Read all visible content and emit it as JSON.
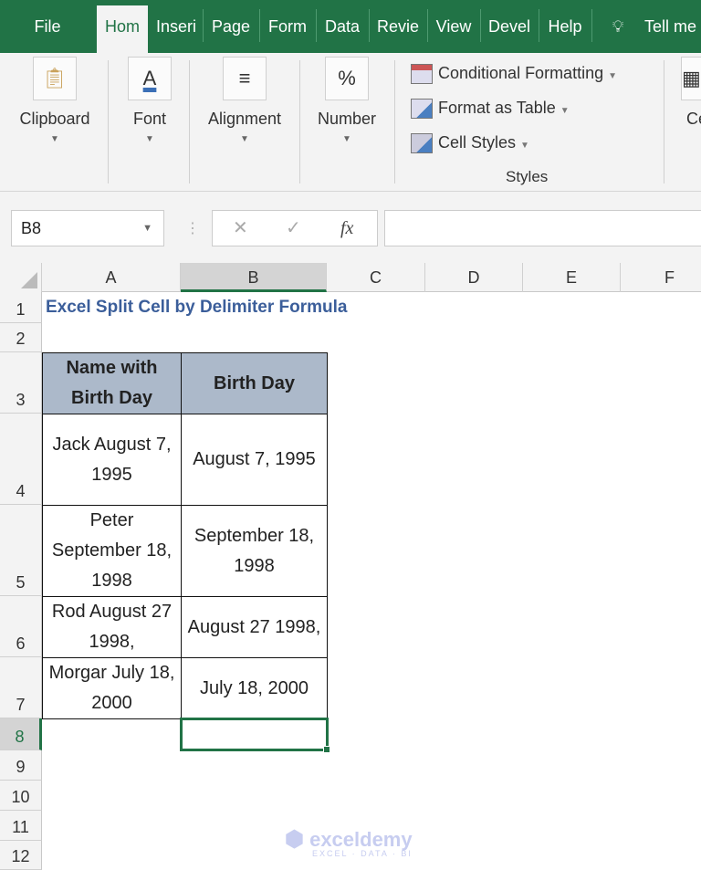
{
  "ribbon_tabs": [
    "File",
    "Hom",
    "Inseri",
    "Page",
    "Form",
    "Data",
    "Revie",
    "View",
    "Devel",
    "Help"
  ],
  "tell_me": "Tell me",
  "groups": {
    "clipboard": "Clipboard",
    "font": "Font",
    "alignment": "Alignment",
    "number": "Number",
    "styles": "Styles",
    "cells_partial": "Ce"
  },
  "styles_items": [
    "Conditional Formatting",
    "Format as Table",
    "Cell Styles"
  ],
  "name_box": "B8",
  "fx": "fx",
  "formula_value": "",
  "columns": [
    "A",
    "B",
    "C",
    "D",
    "E",
    "F"
  ],
  "rows": [
    "1",
    "2",
    "3",
    "4",
    "5",
    "6",
    "7",
    "8",
    "9",
    "10",
    "11",
    "12"
  ],
  "sheet": {
    "title": "Excel Split Cell by Delimiter Formula",
    "headers": [
      "Name with Birth Day",
      "Birth Day"
    ],
    "data": [
      [
        "Jack August 7, 1995",
        "August 7, 1995"
      ],
      [
        "Peter September 18, 1998",
        "September 18, 1998"
      ],
      [
        "Rod August 27 1998,",
        "August 27 1998,"
      ],
      [
        "Morgar July 18, 2000",
        "July 18, 2000"
      ]
    ]
  },
  "selected_cell": "B8",
  "watermark": {
    "name": "exceldemy",
    "tagline": "EXCEL · DATA · BI"
  },
  "colors": {
    "excel_green": "#217346",
    "header_fill": "#acb9ca",
    "title_color": "#3b5e9a"
  }
}
